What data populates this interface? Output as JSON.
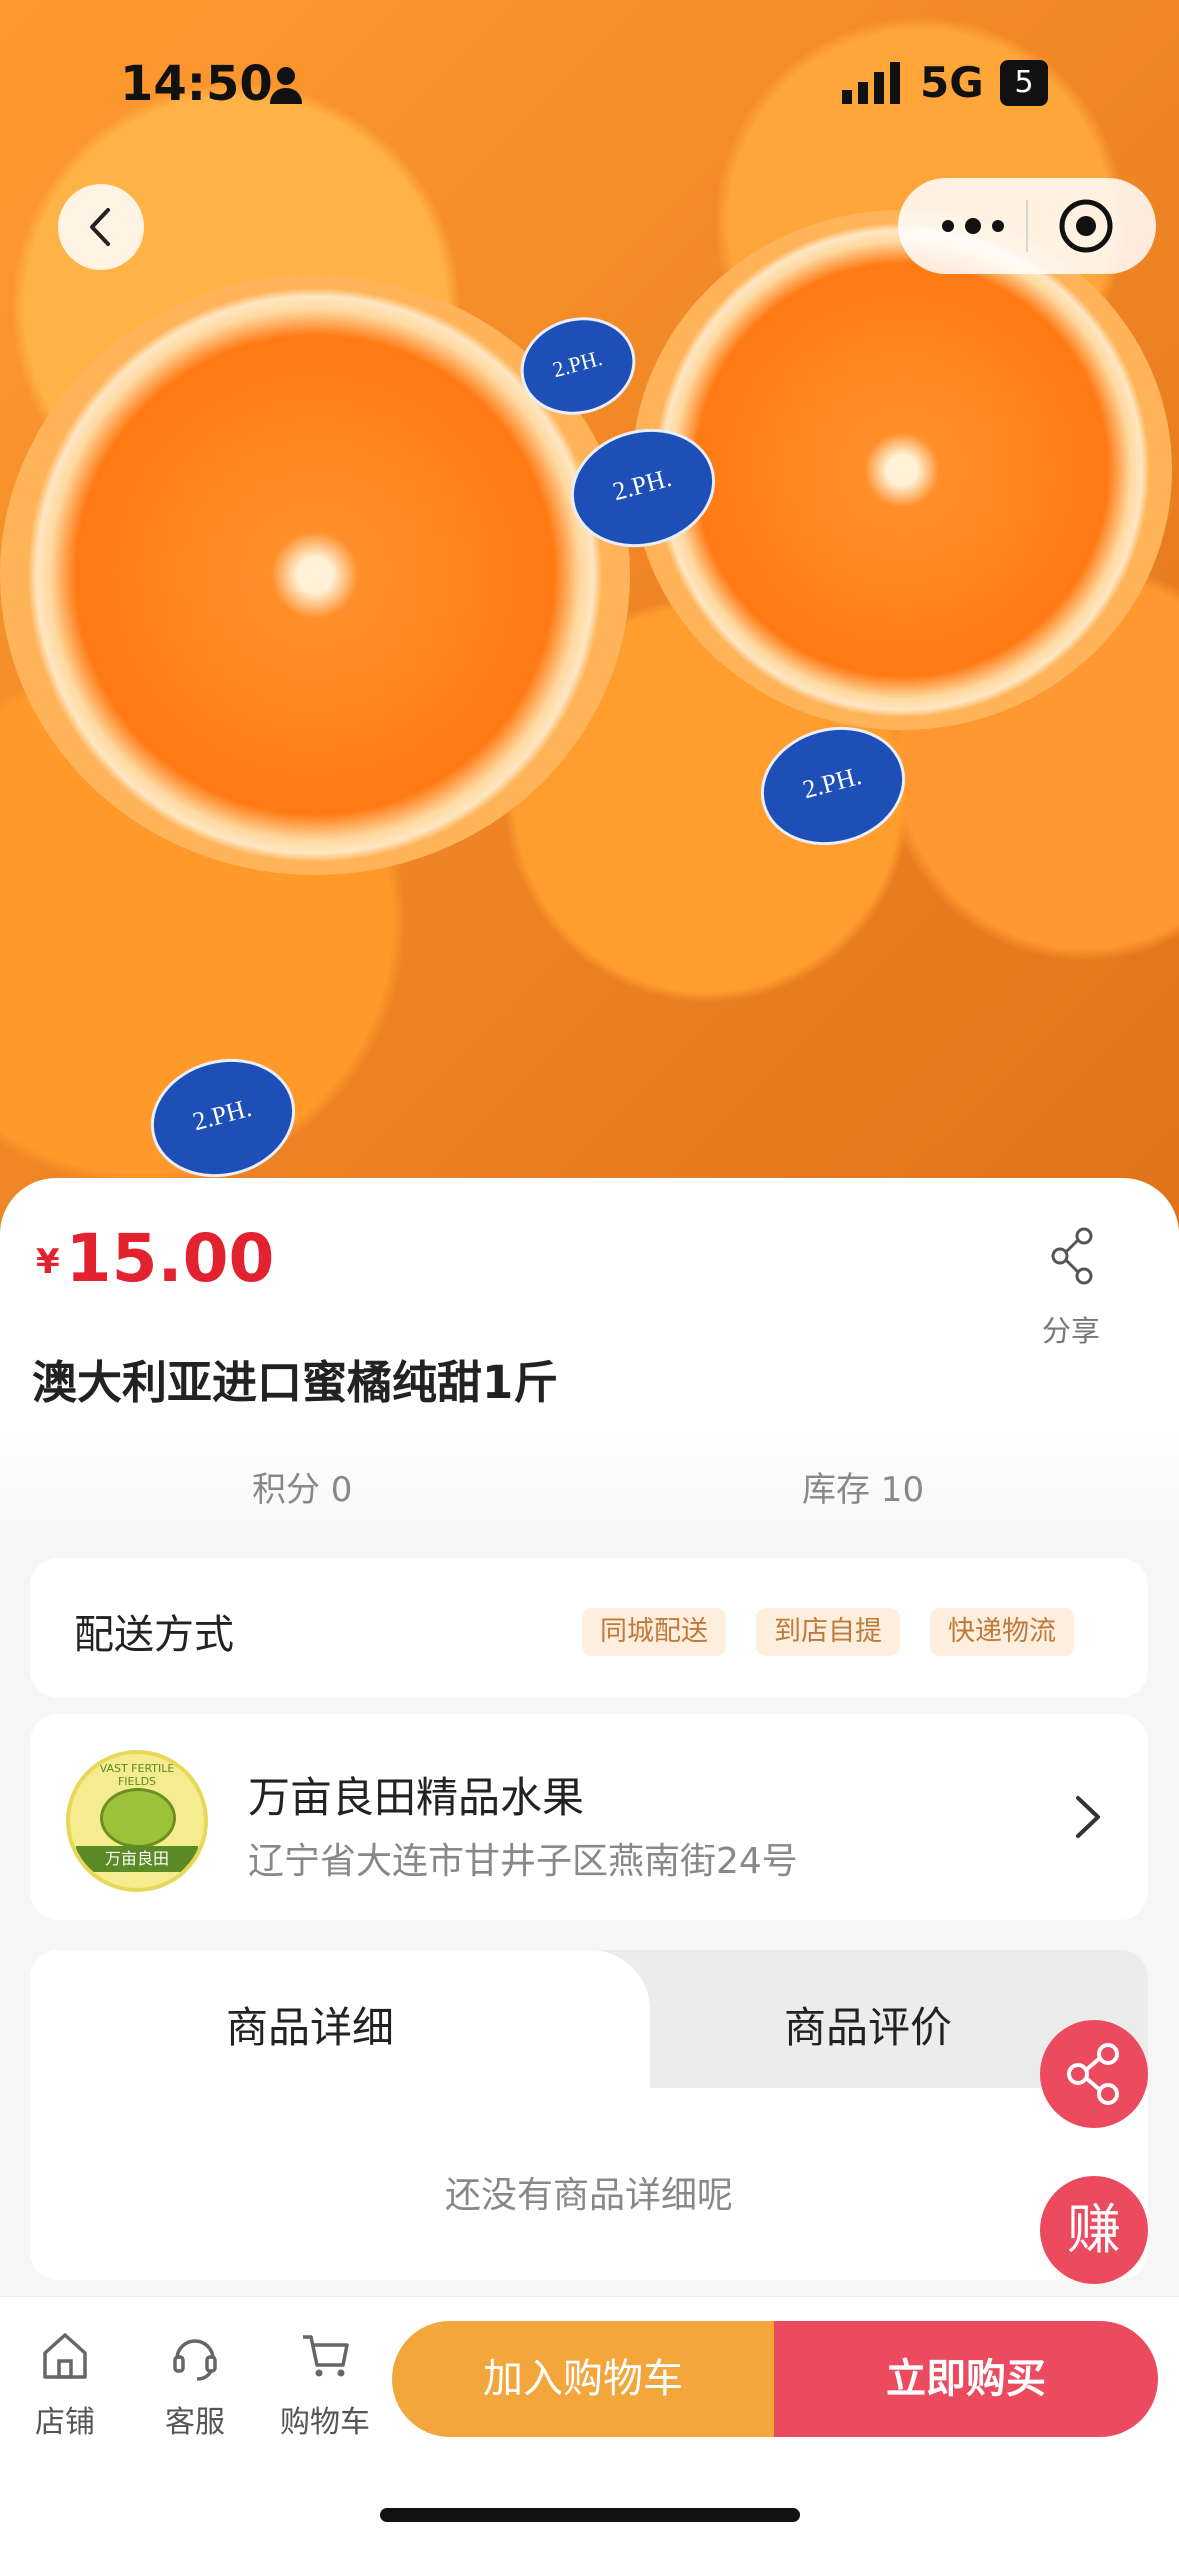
{
  "status_bar": {
    "time": "14:50",
    "network": "5G",
    "battery": "5"
  },
  "hero": {
    "sticker_text": "2.PH."
  },
  "product": {
    "currency_symbol": "¥",
    "price": "15.00",
    "title": "澳大利亚进口蜜橘纯甜1斤",
    "share_label": "分享",
    "points": "积分 0",
    "stock": "库存 10"
  },
  "delivery": {
    "label": "配送方式",
    "options": [
      "同城配送",
      "到店自提",
      "快递物流"
    ]
  },
  "store": {
    "name": "万亩良田精品水果",
    "address": "辽宁省大连市甘井子区燕南街24号",
    "logo_text": "万亩良田",
    "logo_arc": "VAST FERTILE FIELDS"
  },
  "detail": {
    "tabs": [
      "商品详细",
      "商品评价"
    ],
    "active_tab": "商品详细",
    "empty_text": "还没有商品详细呢"
  },
  "float": {
    "earn_label": "赚"
  },
  "bottom_bar": {
    "items": [
      "店铺",
      "客服",
      "购物车"
    ],
    "add_cart": "加入购物车",
    "buy_now": "立即购买"
  },
  "colors": {
    "price": "#e3222f",
    "add_cart": "#f2a63c",
    "buy_now": "#ec4a5e",
    "tag_bg": "#fdeede"
  }
}
